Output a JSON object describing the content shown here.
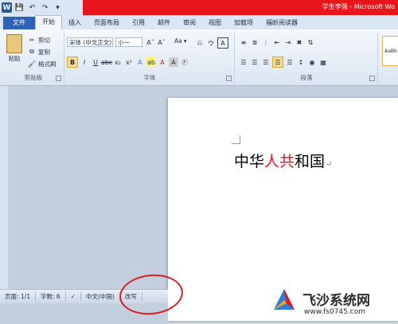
{
  "window": {
    "title": "学生李强 - Microsoft Wo"
  },
  "ribbon_tabs": [
    "文件",
    "开始",
    "插入",
    "页面布局",
    "引用",
    "邮件",
    "审阅",
    "视图",
    "加载项",
    "福昕阅读器"
  ],
  "clipboard": {
    "paste": "粘贴",
    "cut": "剪切",
    "copy": "复制",
    "format_painter": "格式刷",
    "label": "剪贴板"
  },
  "font": {
    "name": "宋体 (中文正文)",
    "size": "小一",
    "label": "字体",
    "clear": "Aa"
  },
  "paragraph": {
    "label": "段落"
  },
  "styles": {
    "preview": "AaBb"
  },
  "document": {
    "text_part1": "中华",
    "text_red": "人共",
    "text_part2": "和国"
  },
  "statusbar": {
    "page": "页面: 1/1",
    "words": "字数: 6",
    "language": "中文(中国)",
    "mode": "改写"
  },
  "watermark": {
    "name": "飞沙系统网",
    "url": "www.fs0745.com"
  },
  "colors": {
    "accent": "#2e62b6",
    "title_red": "#e8151a",
    "doc_red": "#e3141b",
    "annotation": "#d8201f"
  }
}
